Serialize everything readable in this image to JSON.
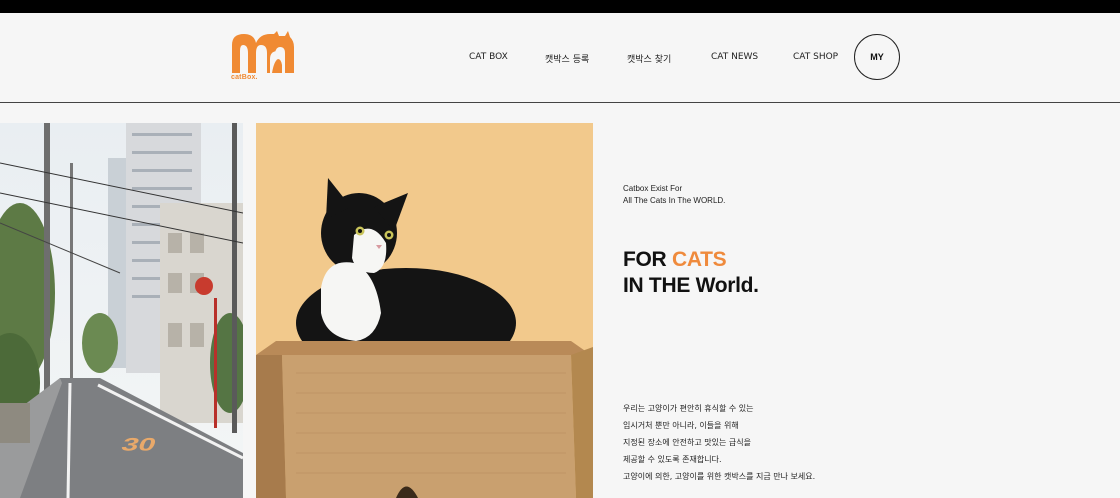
{
  "brand": {
    "logo_text": "catBox.",
    "accent_color": "#ef8a3c"
  },
  "nav": {
    "items": [
      {
        "label": "CAT BOX"
      },
      {
        "label": "캣박스 등록"
      },
      {
        "label": "캣박스 찾기"
      },
      {
        "label": "CAT NEWS"
      },
      {
        "label": "CAT SHOP"
      }
    ],
    "my_label": "MY"
  },
  "hero": {
    "tagline_line1": "Catbox Exist For",
    "tagline_line2": "All The Cats In The WORLD.",
    "headline_for": "FOR",
    "headline_cats": "CATS",
    "headline_line2": "IN THE World.",
    "body_lines": [
      "우리는 고양이가 편안히 휴식할 수 있는",
      "임시거처 뿐만 아니라, 이들을 위해",
      "지정된 장소에 안전하고 맛있는 급식을",
      "제공할 수 있도록 존재합니다.",
      "고양이에 의한, 고양이를 위한 캣박스를 지금 만나 보세요."
    ]
  },
  "images": {
    "street": {
      "road_marking": "30"
    }
  }
}
